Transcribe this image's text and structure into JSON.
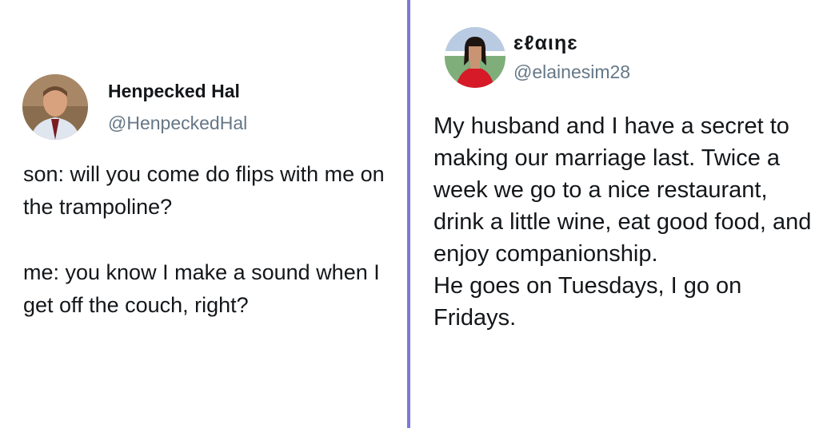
{
  "tweets": [
    {
      "display_name": "Henpecked Hal",
      "handle": "@HenpeckedHal",
      "text": "son: will you come do flips with me on the trampoline?\n\nme: you know I make a sound when I get off the couch, right?"
    },
    {
      "display_name": "ɛℓαιηɛ",
      "handle": "@elainesim28",
      "text": "My husband and I have a secret to making our marriage last. Twice a week we go to a nice restaurant, drink a little wine, eat good food, and enjoy companionship.\nHe goes on Tuesdays, I go on Fridays."
    }
  ],
  "colors": {
    "divider": "#7d78d9",
    "text": "#14171a",
    "handle": "#657786"
  }
}
